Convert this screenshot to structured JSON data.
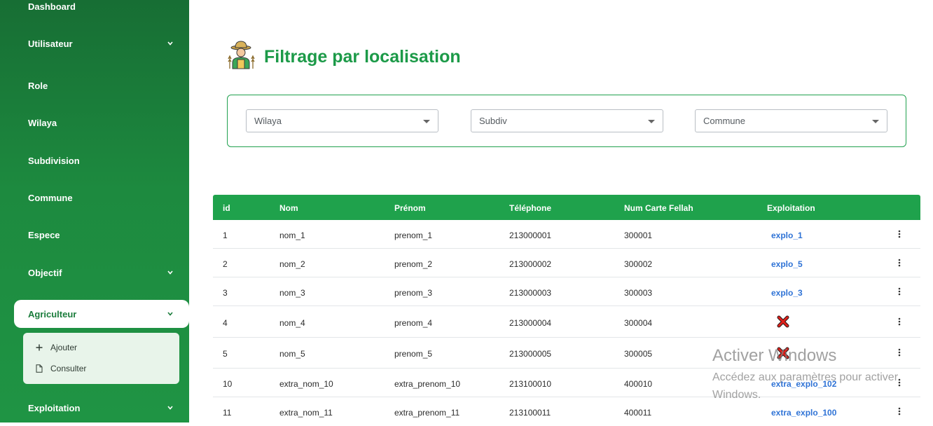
{
  "sidebar": {
    "items": [
      {
        "label": "Dashboard",
        "has_chevron": false
      },
      {
        "label": "Utilisateur",
        "has_chevron": true
      },
      {
        "label": "Role",
        "has_chevron": false
      },
      {
        "label": "Wilaya",
        "has_chevron": false
      },
      {
        "label": "Subdivision",
        "has_chevron": false
      },
      {
        "label": "Commune",
        "has_chevron": false
      },
      {
        "label": "Espece",
        "has_chevron": false
      },
      {
        "label": "Objectif",
        "has_chevron": true
      },
      {
        "label": "Agriculteur",
        "has_chevron": true,
        "active": true
      },
      {
        "label": "Exploitation",
        "has_chevron": true
      }
    ],
    "submenu": [
      {
        "label": "Ajouter",
        "icon": "plus-icon"
      },
      {
        "label": "Consulter",
        "icon": "file-icon"
      }
    ],
    "colors": {
      "bg": "#1d8a3f",
      "active_text": "#1a7c3b"
    }
  },
  "page": {
    "title": "Filtrage par localisation",
    "title_icon": "farmer-icon",
    "title_color": "#1c9a48"
  },
  "filters": {
    "wilaya": "Wilaya",
    "subdiv": "Subdiv",
    "commune": "Commune"
  },
  "table": {
    "headers": {
      "id": "id",
      "nom": "Nom",
      "prenom": "Prénom",
      "telephone": "Téléphone",
      "carte": "Num Carte Fellah",
      "exploitation": "Exploitation"
    },
    "header_color": "#1fa24c",
    "rows": [
      {
        "id": "1",
        "nom": "nom_1",
        "prenom": "prenom_1",
        "telephone": "213000001",
        "carte": "300001",
        "exploitation": "explo_1"
      },
      {
        "id": "2",
        "nom": "nom_2",
        "prenom": "prenom_2",
        "telephone": "213000002",
        "carte": "300002",
        "exploitation": "explo_5"
      },
      {
        "id": "3",
        "nom": "nom_3",
        "prenom": "prenom_3",
        "telephone": "213000003",
        "carte": "300003",
        "exploitation": "explo_3"
      },
      {
        "id": "4",
        "nom": "nom_4",
        "prenom": "prenom_4",
        "telephone": "213000004",
        "carte": "300004",
        "exploitation": null
      },
      {
        "id": "5",
        "nom": "nom_5",
        "prenom": "prenom_5",
        "telephone": "213000005",
        "carte": "300005",
        "exploitation": null
      },
      {
        "id": "10",
        "nom": "extra_nom_10",
        "prenom": "extra_prenom_10",
        "telephone": "213100010",
        "carte": "400010",
        "exploitation": "extra_explo_102"
      },
      {
        "id": "11",
        "nom": "extra_nom_11",
        "prenom": "extra_prenom_11",
        "telephone": "213100011",
        "carte": "400011",
        "exploitation": "extra_explo_100"
      }
    ]
  },
  "watermark": {
    "line1": "Activer Windows",
    "line2": "Accédez aux paramètres pour activer",
    "line3": "Windows."
  }
}
